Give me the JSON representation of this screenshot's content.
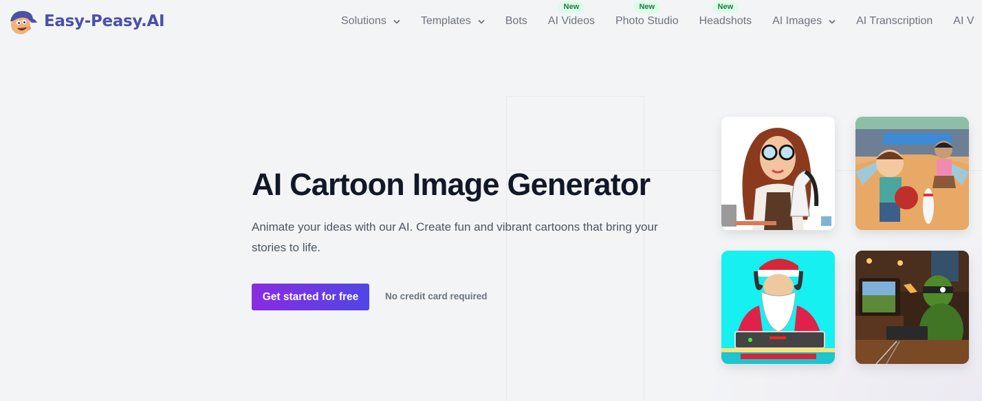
{
  "brand": {
    "name": "Easy-Peasy.AI",
    "logo_icon": "cartoon-mascot-icon",
    "color": "#4a51a8"
  },
  "nav": {
    "items": [
      {
        "label": "Solutions",
        "dropdown": true,
        "badge": null
      },
      {
        "label": "Templates",
        "dropdown": true,
        "badge": null
      },
      {
        "label": "Bots",
        "dropdown": false,
        "badge": null
      },
      {
        "label": "AI Videos",
        "dropdown": false,
        "badge": "New"
      },
      {
        "label": "Photo Studio",
        "dropdown": false,
        "badge": "New"
      },
      {
        "label": "Headshots",
        "dropdown": false,
        "badge": "New"
      },
      {
        "label": "AI Images",
        "dropdown": true,
        "badge": null
      },
      {
        "label": "AI Transcription",
        "dropdown": false,
        "badge": null
      },
      {
        "label": "AI V",
        "dropdown": false,
        "badge": null
      }
    ],
    "badge_color": "#15803d",
    "badge_bg": "#dcfce7"
  },
  "hero": {
    "title": "AI Cartoon Image Generator",
    "subtitle": "Animate your ideas with our AI. Create fun and vibrant cartoons that bring your stories to life.",
    "cta_label": "Get started for free",
    "cta_note": "No credit card required",
    "cta_gradient": [
      "#8a2be2",
      "#4f46e5"
    ]
  },
  "gallery": [
    {
      "alt": "Cartoon woman with glasses painting a horse figurine"
    },
    {
      "alt": "Cartoon kids bowling"
    },
    {
      "alt": "Cartoon Santa DJ with headphones"
    },
    {
      "alt": "Turtle playing retro video game"
    }
  ]
}
